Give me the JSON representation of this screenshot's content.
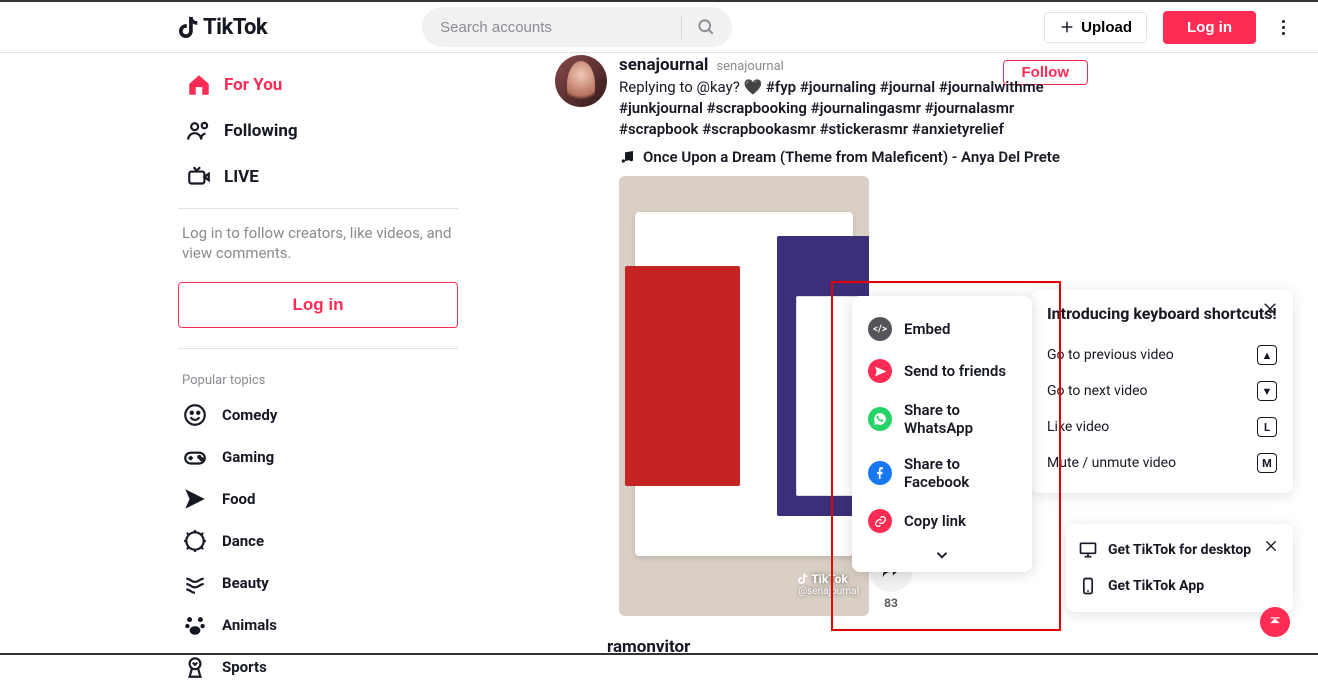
{
  "brand": "TikTok",
  "search": {
    "placeholder": "Search accounts"
  },
  "header": {
    "upload": "Upload",
    "login": "Log in"
  },
  "sidebar": {
    "nav": {
      "for_you": "For You",
      "following": "Following",
      "live": "LIVE"
    },
    "login_hint": "Log in to follow creators, like videos, and view comments.",
    "login_btn": "Log in",
    "topics_label": "Popular topics",
    "topics": {
      "comedy": "Comedy",
      "gaming": "Gaming",
      "food": "Food",
      "dance": "Dance",
      "beauty": "Beauty",
      "animals": "Animals",
      "sports": "Sports"
    }
  },
  "post": {
    "display_name": "senajournal",
    "handle": "senajournal",
    "caption_prefix": "Replying to @kay? 🖤 ",
    "hashtags": "#fyp #journaling #journal #journalwithme #junkjournal #scrapbooking #journalingasmr #journalasmr #scrapbook #scrapbookasmr #stickerasmr #anxietyrelief",
    "sound": "Once Upon a Dream (Theme from Maleficent) - Anya Del Prete",
    "follow": "Follow",
    "watermark_brand": "TikTok",
    "watermark_user": "@senajournal",
    "share_count": "83"
  },
  "share": {
    "embed": "Embed",
    "send": "Send to friends",
    "whatsapp": "Share to WhatsApp",
    "facebook": "Share to Facebook",
    "copy": "Copy link"
  },
  "kb": {
    "title": "Introducing keyboard shortcuts!",
    "prev": "Go to previous video",
    "next": "Go to next video",
    "like": "Like video",
    "mute": "Mute / unmute video",
    "key_prev": "▲",
    "key_next": "▼",
    "key_like": "L",
    "key_mute": "M"
  },
  "download": {
    "desktop": "Get TikTok for desktop",
    "app": "Get TikTok App"
  },
  "next_post_name": "ramonvitor"
}
